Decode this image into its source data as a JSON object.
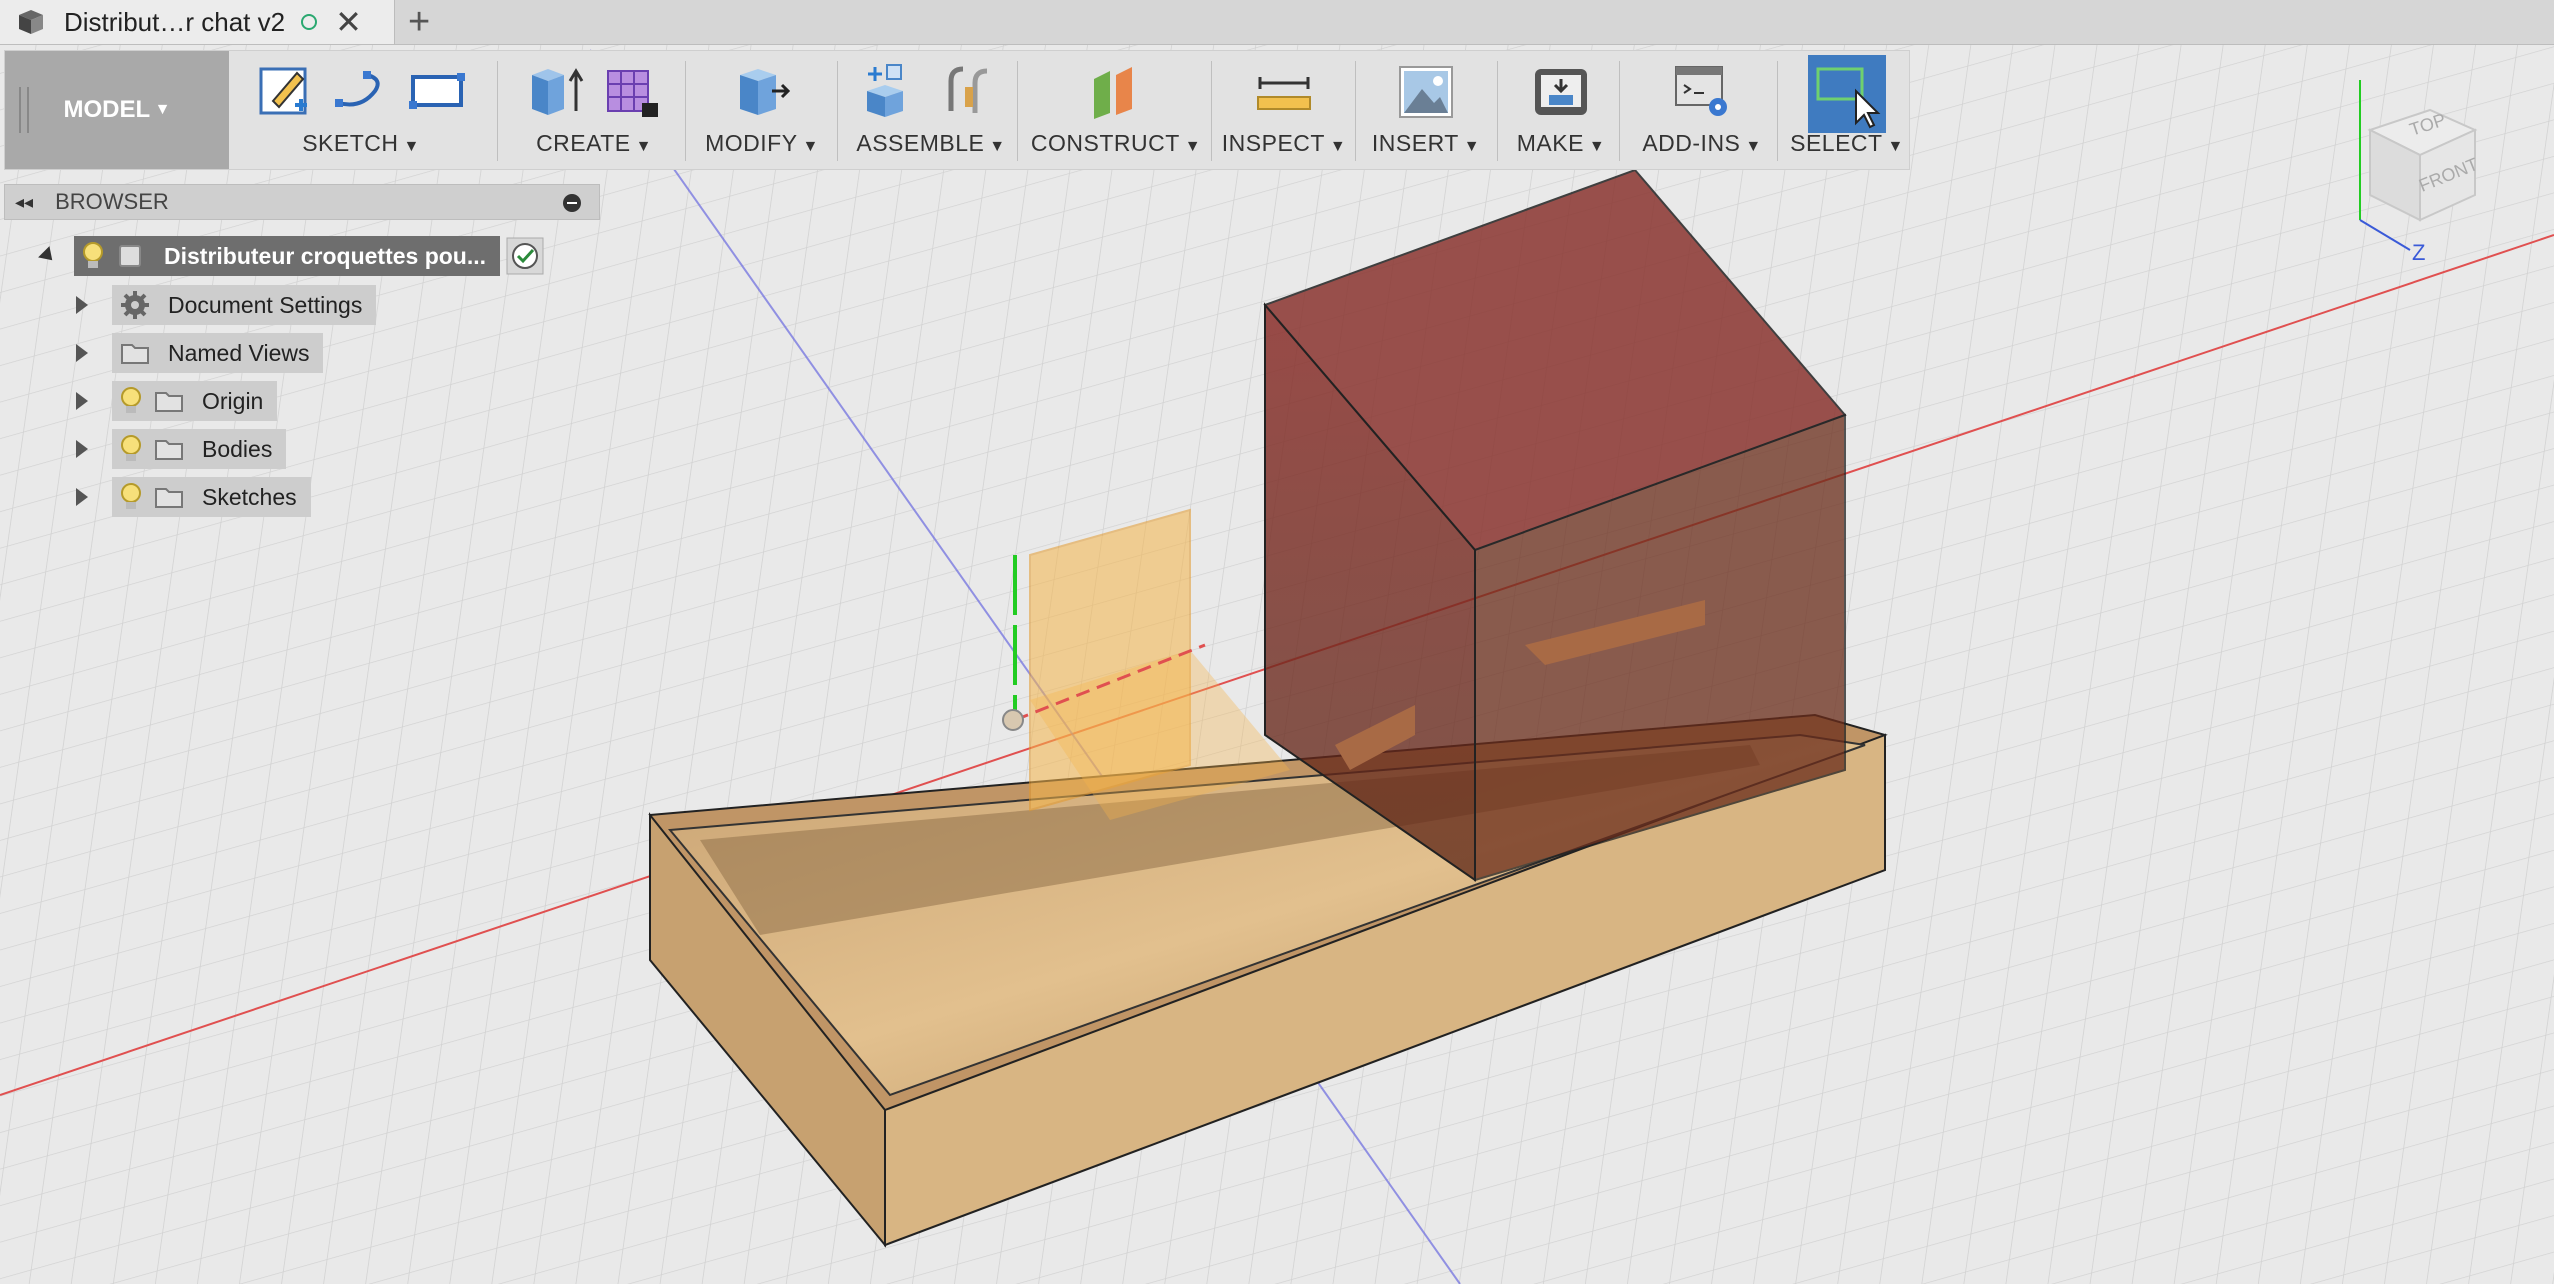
{
  "tab": {
    "title": "Distribut…r chat v2",
    "close": "✕",
    "new_tab": "+"
  },
  "toolbar": {
    "model_label": "MODEL",
    "groups": [
      {
        "label": "SKETCH"
      },
      {
        "label": "CREATE"
      },
      {
        "label": "MODIFY"
      },
      {
        "label": "ASSEMBLE"
      },
      {
        "label": "CONSTRUCT"
      },
      {
        "label": "INSPECT"
      },
      {
        "label": "INSERT"
      },
      {
        "label": "MAKE"
      },
      {
        "label": "ADD-INS"
      },
      {
        "label": "SELECT"
      }
    ]
  },
  "browser": {
    "title": "BROWSER",
    "root": "Distributeur croquettes pou...",
    "items": [
      {
        "label": "Document Settings"
      },
      {
        "label": "Named Views"
      },
      {
        "label": "Origin"
      },
      {
        "label": "Bodies"
      },
      {
        "label": "Sketches"
      }
    ]
  },
  "viewcube": {
    "top": "TOP",
    "front": "FRONT",
    "z_axis": "Z"
  },
  "colors": {
    "grid_bg": "#e9e9e9",
    "box_tan": "#d9b585",
    "hopper_red": "#7a2a24",
    "plane_orange": "#f5b54a",
    "select_blue": "#3f7bc0"
  }
}
